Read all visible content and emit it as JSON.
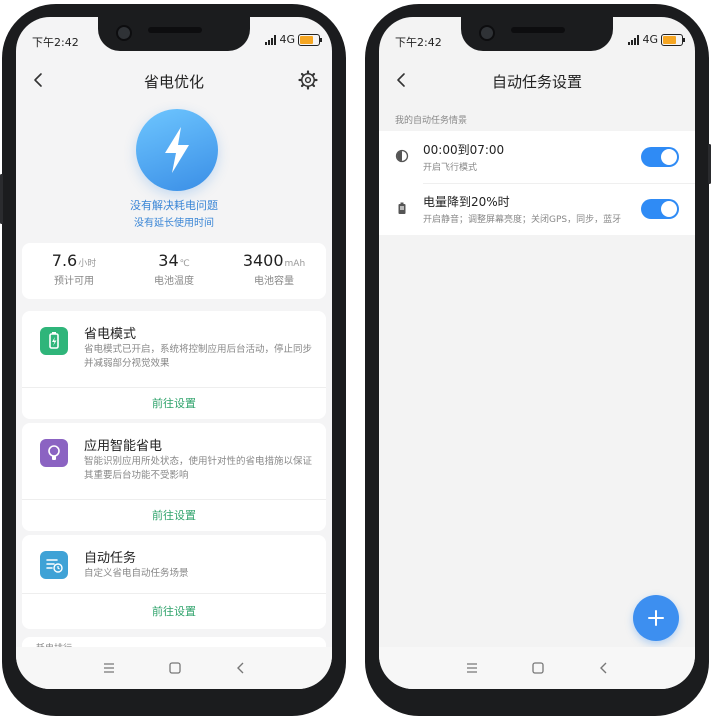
{
  "colors": {
    "accent_blue": "#3a8ee6",
    "link_green": "#2fa36b",
    "toggle_on": "#2f8bf5",
    "battery_mode_icon": "#2fb57a",
    "smart_saver_icon": "#8b63c2",
    "auto_task_icon": "#3fa2d6"
  },
  "left": {
    "status": {
      "time": "下午2:42",
      "network": "4G"
    },
    "header": {
      "title": "省电优化"
    },
    "hero": {
      "line1": "没有解决耗电问题",
      "line2": "没有延长使用时间"
    },
    "stats": [
      {
        "value": "7.6",
        "unit": "小时",
        "label": "预计可用"
      },
      {
        "value": "34",
        "unit": "℃",
        "label": "电池温度"
      },
      {
        "value": "3400",
        "unit": "mAh",
        "label": "电池容量"
      }
    ],
    "features": [
      {
        "title": "省电模式",
        "desc": "省电模式已开启，系统将控制应用后台活动，停止同步并减弱部分视觉效果",
        "link": "前往设置",
        "icon": "battery-mode-icon"
      },
      {
        "title": "应用智能省电",
        "desc": "智能识别应用所处状态，使用针对性的省电措施以保证其重要后台功能不受影响",
        "link": "前往设置",
        "icon": "lightbulb-icon"
      },
      {
        "title": "自动任务",
        "desc": "自定义省电自动任务场景",
        "link": "前往设置",
        "icon": "task-list-icon"
      }
    ],
    "peek": "耗电排行"
  },
  "right": {
    "status": {
      "time": "下午2:42",
      "network": "4G"
    },
    "header": {
      "title": "自动任务设置"
    },
    "section_label": "我的自动任务情景",
    "tasks": [
      {
        "title": "00:00到07:00",
        "desc": "开启飞行模式",
        "enabled": true,
        "icon": "clock-icon"
      },
      {
        "title": "电量降到20%时",
        "desc": "开启静音；调整屏幕亮度；关闭GPS，同步，蓝牙",
        "enabled": true,
        "icon": "battery-low-icon"
      }
    ]
  }
}
